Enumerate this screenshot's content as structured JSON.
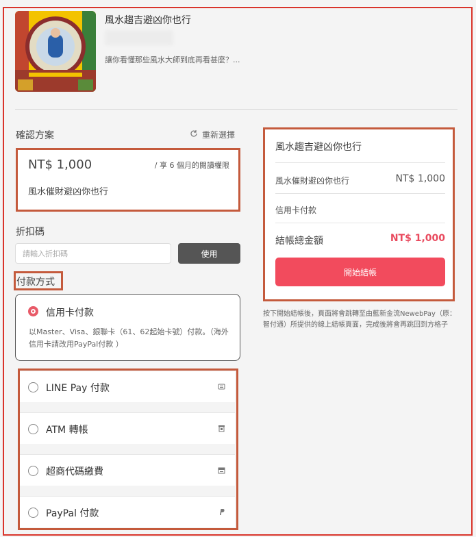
{
  "product": {
    "title": "風水趨吉避凶你也行",
    "description": "讓你看懂那些風水大師到底再看甚麼？..."
  },
  "plan_section": {
    "label": "確認方案",
    "reselect_label": "重新選擇",
    "price": "NT$ 1,000",
    "term": "/ 享 6 個月的閱讀權限",
    "name": "風水催財避凶你也行"
  },
  "coupon": {
    "label": "折扣碼",
    "placeholder": "請輸入折扣碼",
    "button_label": "使用"
  },
  "payment": {
    "label": "付款方式",
    "credit_card": {
      "label": "信用卡付款",
      "description": "以Master、Visa、銀聯卡（61、62起始卡號）付款。（海外信用卡請改用PayPal付款 ）",
      "selected": true
    },
    "methods": [
      {
        "label": "LINE Pay 付款",
        "icon": "line-pay-icon"
      },
      {
        "label": "ATM 轉帳",
        "icon": "bank-icon"
      },
      {
        "label": "超商代碼繳費",
        "icon": "store-icon"
      },
      {
        "label": "PayPal 付款",
        "icon": "paypal-icon"
      }
    ]
  },
  "summary": {
    "title": "風水趨吉避凶你也行",
    "item_label": "風水催財避凶你也行",
    "item_price": "NT$ 1,000",
    "payment_method": "信用卡付款",
    "total_label": "結帳總金額",
    "total_price": "NT$ 1,000",
    "checkout_label": "開始結帳",
    "note": "按下開始結帳後，頁面將會跳轉至由藍新金流NewebPay（原：智付通）所提供的線上結帳頁面，完成後將會再跳回到方格子"
  },
  "colors": {
    "accent": "#f24b5d",
    "annotation_box": "#c45a3c",
    "outer_frame": "#d9342b"
  }
}
